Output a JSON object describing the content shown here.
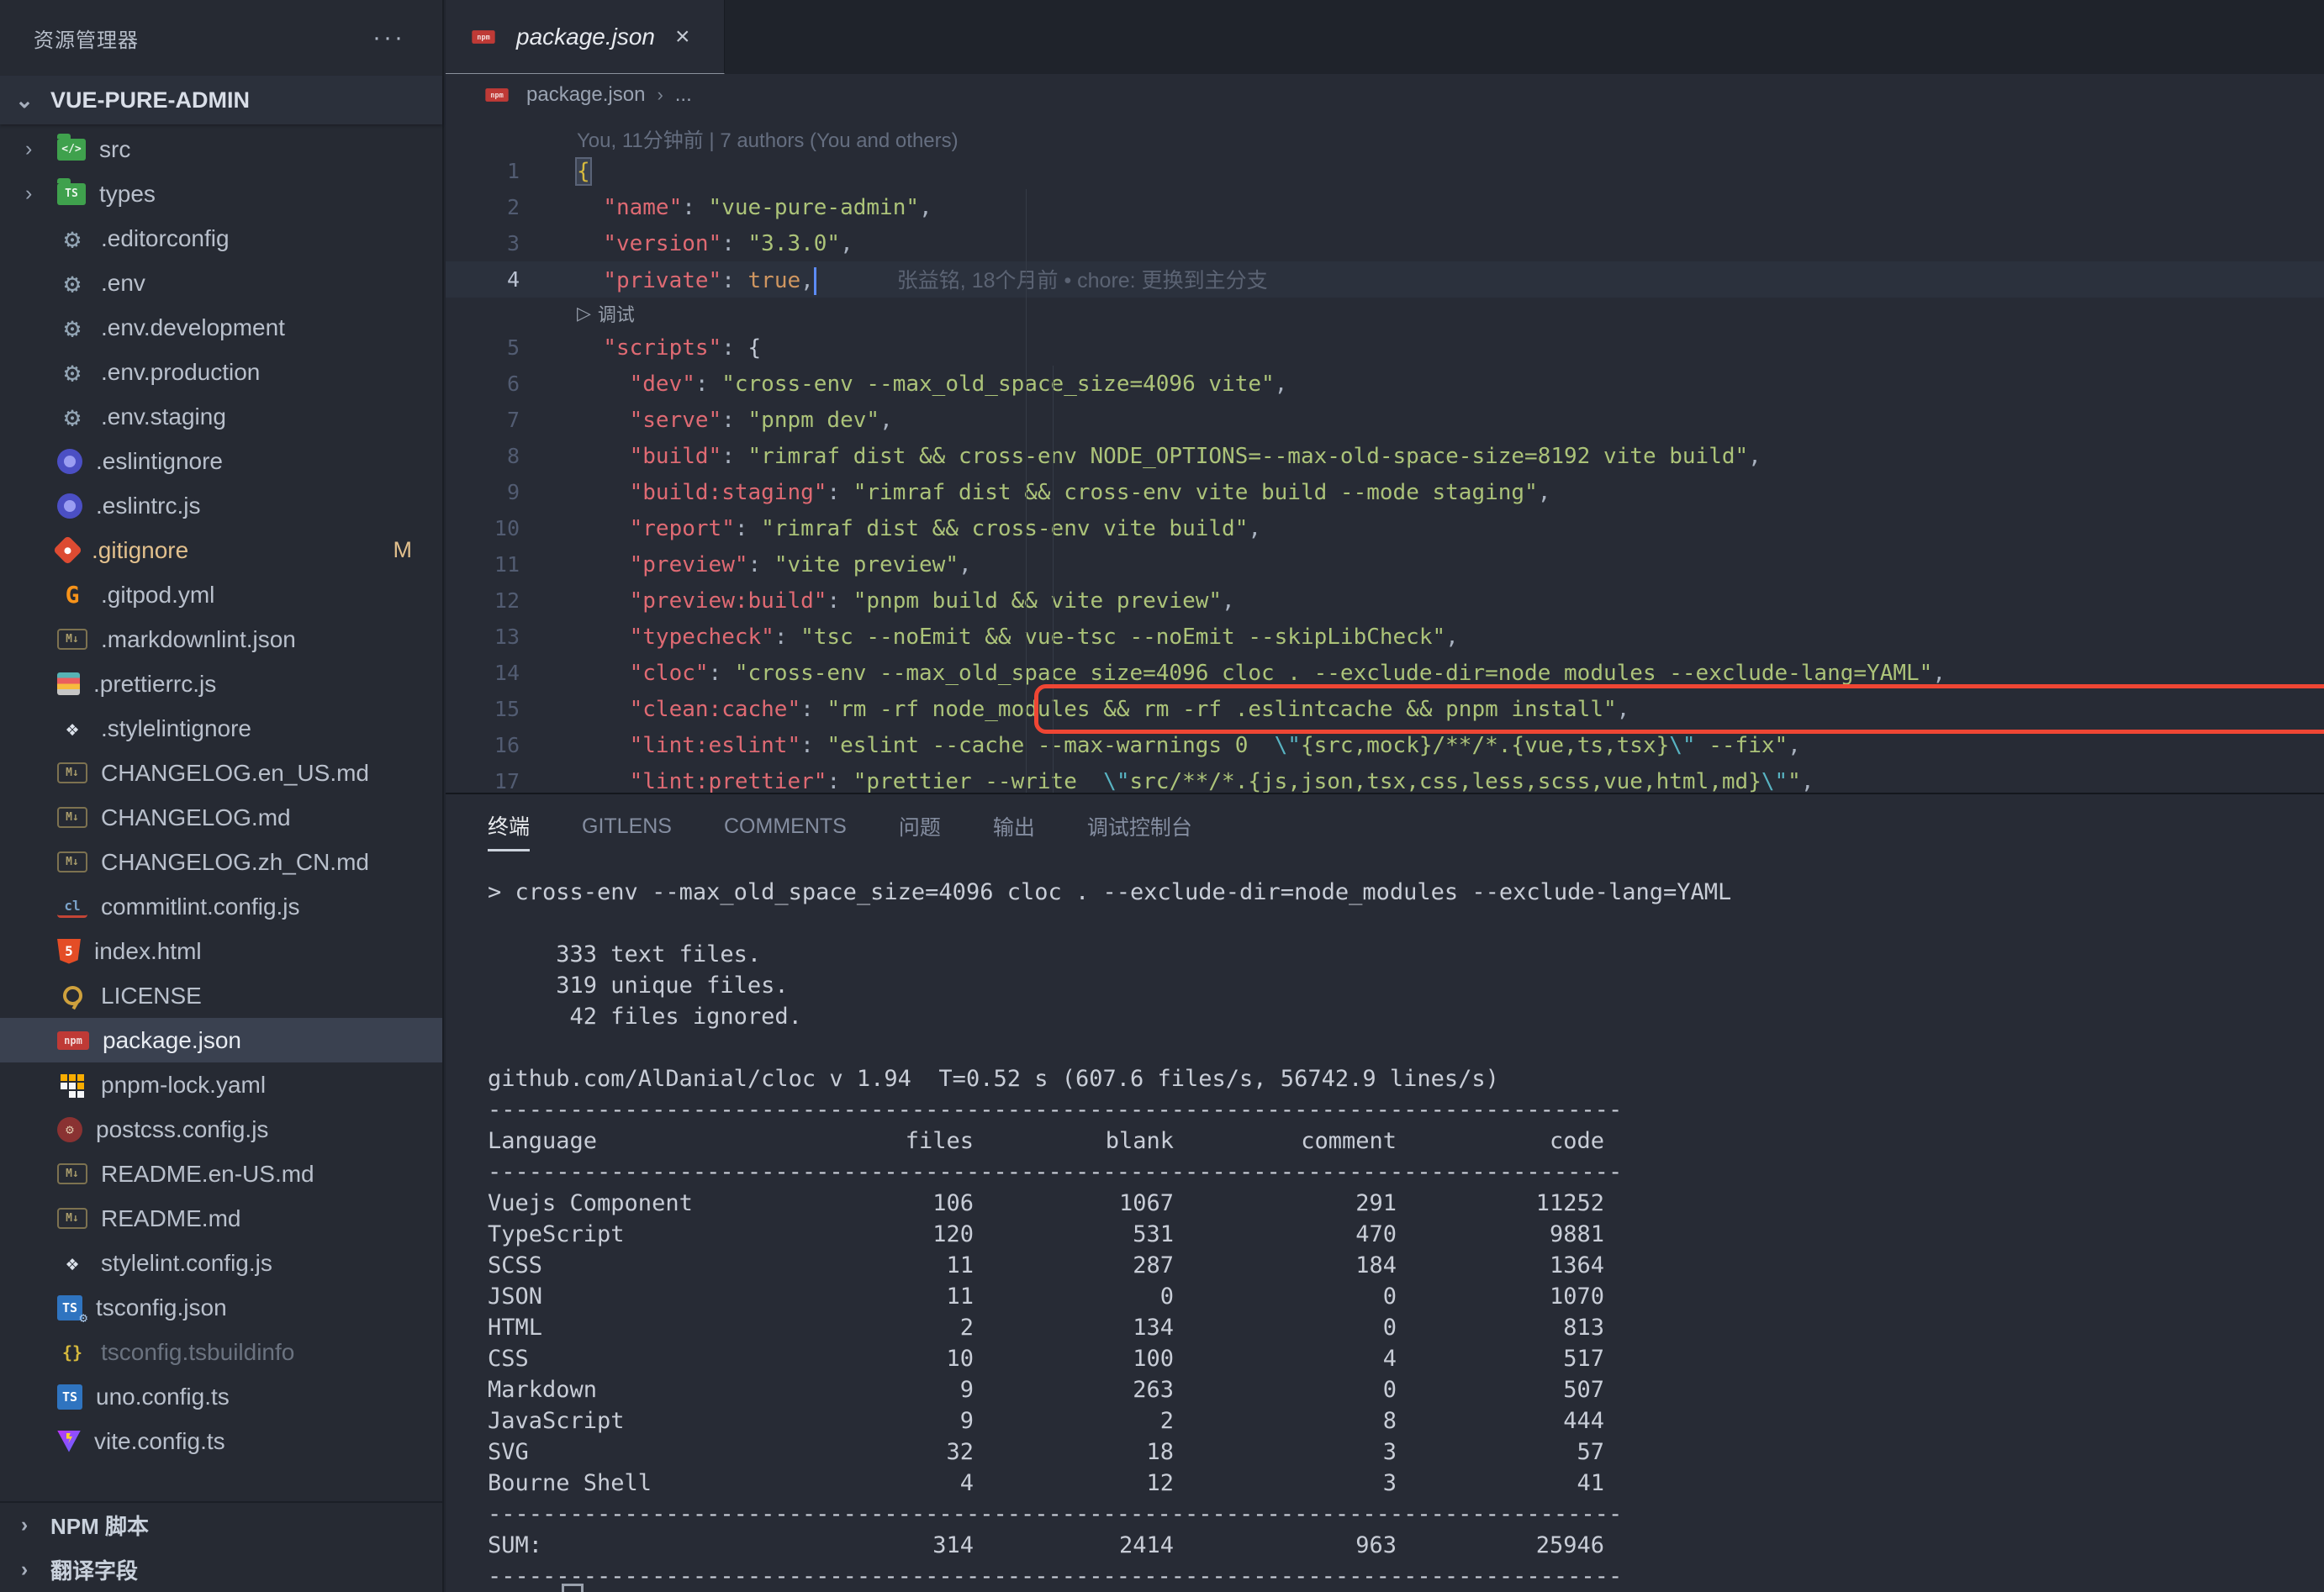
{
  "colors": {
    "accent_red": "#ef4634",
    "modified": "#e2c08d",
    "key": "#df6a73",
    "string": "#acc379",
    "boolean": "#cf9660",
    "selection_bg": "#3a4150"
  },
  "glyphs": {
    "more": "···",
    "chevron_down": "⌄",
    "chevron_right": "›",
    "close": "×",
    "play": "▷",
    "gear": "⚙"
  },
  "sidebar": {
    "title": "资源管理器",
    "project": "VUE-PURE-ADMIN",
    "files": [
      {
        "label": "src",
        "icon": "folder-src",
        "folder": true
      },
      {
        "label": "types",
        "icon": "folder-types",
        "folder": true
      },
      {
        "label": ".editorconfig",
        "icon": "editorconfig"
      },
      {
        "label": ".env",
        "icon": "gear"
      },
      {
        "label": ".env.development",
        "icon": "gear"
      },
      {
        "label": ".env.production",
        "icon": "gear"
      },
      {
        "label": ".env.staging",
        "icon": "gear"
      },
      {
        "label": ".eslintignore",
        "icon": "eslint"
      },
      {
        "label": ".eslintrc.js",
        "icon": "eslint"
      },
      {
        "label": ".gitignore",
        "icon": "git",
        "modified": true,
        "badge": "M"
      },
      {
        "label": ".gitpod.yml",
        "icon": "gitpod"
      },
      {
        "label": ".markdownlint.json",
        "icon": "mdlint"
      },
      {
        "label": ".prettierrc.js",
        "icon": "prettier"
      },
      {
        "label": ".stylelintignore",
        "icon": "stylelint"
      },
      {
        "label": "CHANGELOG.en_US.md",
        "icon": "markdown"
      },
      {
        "label": "CHANGELOG.md",
        "icon": "markdown"
      },
      {
        "label": "CHANGELOG.zh_CN.md",
        "icon": "markdown"
      },
      {
        "label": "commitlint.config.js",
        "icon": "commitlint"
      },
      {
        "label": "index.html",
        "icon": "html"
      },
      {
        "label": "LICENSE",
        "icon": "license"
      },
      {
        "label": "package.json",
        "icon": "npm",
        "selected": true
      },
      {
        "label": "pnpm-lock.yaml",
        "icon": "pnpm"
      },
      {
        "label": "postcss.config.js",
        "icon": "postcss"
      },
      {
        "label": "README.en-US.md",
        "icon": "markdown"
      },
      {
        "label": "README.md",
        "icon": "markdown"
      },
      {
        "label": "stylelint.config.js",
        "icon": "stylelint"
      },
      {
        "label": "tsconfig.json",
        "icon": "ts-gear"
      },
      {
        "label": "tsconfig.tsbuildinfo",
        "icon": "braces",
        "dimmed": true
      },
      {
        "label": "uno.config.ts",
        "icon": "ts"
      },
      {
        "label": "vite.config.ts",
        "icon": "vite"
      }
    ],
    "sections": [
      "NPM 脚本",
      "翻译字段"
    ]
  },
  "tab": {
    "label": "package.json"
  },
  "breadcrumb": {
    "file": "package.json",
    "more": "..."
  },
  "editor": {
    "authors_lens": "You, 11分钟前 | 7 authors (You and others)",
    "lines": [
      {
        "n": 1,
        "raw": "{"
      },
      {
        "n": 2,
        "ind": "  ",
        "key": "\"name\"",
        "val": "\"vue-pure-admin\"",
        "end": ","
      },
      {
        "n": 3,
        "ind": "  ",
        "key": "\"version\"",
        "val": "\"3.3.0\"",
        "end": ","
      },
      {
        "n": 4,
        "ind": "  ",
        "key": "\"private\"",
        "val": "true",
        "vc": "b",
        "end": ",",
        "cursor": true,
        "blame": "张益铭, 18个月前 • chore: 更换到主分支",
        "current": true
      },
      {
        "lens": "调试"
      },
      {
        "n": 5,
        "ind": "  ",
        "key": "\"scripts\"",
        "val": "{",
        "vc": "w",
        "end": ""
      },
      {
        "n": 6,
        "ind": "    ",
        "key": "\"dev\"",
        "val": "\"cross-env --max_old_space_size=4096 vite\"",
        "end": ","
      },
      {
        "n": 7,
        "ind": "    ",
        "key": "\"serve\"",
        "val": "\"pnpm dev\"",
        "end": ","
      },
      {
        "n": 8,
        "ind": "    ",
        "key": "\"build\"",
        "val": "\"rimraf dist && cross-env NODE_OPTIONS=--max-old-space-size=8192 vite build\"",
        "end": ","
      },
      {
        "n": 9,
        "ind": "    ",
        "key": "\"build:staging\"",
        "val": "\"rimraf dist && cross-env vite build --mode staging\"",
        "end": ","
      },
      {
        "n": 10,
        "ind": "    ",
        "key": "\"report\"",
        "val": "\"rimraf dist && cross-env vite build\"",
        "end": ","
      },
      {
        "n": 11,
        "ind": "    ",
        "key": "\"preview\"",
        "val": "\"vite preview\"",
        "end": ","
      },
      {
        "n": 12,
        "ind": "    ",
        "key": "\"preview:build\"",
        "val": "\"pnpm build && vite preview\"",
        "end": ","
      },
      {
        "n": 13,
        "ind": "    ",
        "key": "\"typecheck\"",
        "val": "\"tsc --noEmit && vue-tsc --noEmit --skipLibCheck\"",
        "end": ","
      },
      {
        "n": 14,
        "ind": "    ",
        "key": "\"cloc\"",
        "val": "\"cross-env --max_old_space_size=4096 cloc . --exclude-dir=node_modules --exclude-lang=YAML\"",
        "end": ",",
        "highlight": true
      },
      {
        "n": 15,
        "ind": "    ",
        "key": "\"clean:cache\"",
        "val": "\"rm -rf node_modules && rm -rf .eslintcache && pnpm install\"",
        "end": ","
      },
      {
        "n": 16,
        "ind": "    ",
        "key": "\"lint:eslint\"",
        "val": "\"eslint --cache --max-warnings 0  \\\"{src,mock}/**/*.{vue,ts,tsx}\\\" --fix\"",
        "end": ","
      },
      {
        "n": 17,
        "ind": "    ",
        "key": "\"lint:prettier\"",
        "val": "\"prettier --write  \\\"src/**/*.{js,json,tsx,css,less,scss,vue,html,md}\\\"\"",
        "end": ","
      }
    ]
  },
  "panel": {
    "tabs": [
      {
        "label": "终端",
        "active": true
      },
      {
        "label": "GITLENS"
      },
      {
        "label": "COMMENTS"
      },
      {
        "label": "问题"
      },
      {
        "label": "输出"
      },
      {
        "label": "调试控制台"
      }
    ]
  },
  "terminal": {
    "command": "> cross-env --max_old_space_size=4096 cloc . --exclude-dir=node_modules --exclude-lang=YAML",
    "summary": [
      "     333 text files.",
      "     319 unique files.",
      "      42 files ignored."
    ],
    "info": "github.com/AlDanial/cloc v 1.94  T=0.52 s (607.6 files/s, 56742.9 lines/s)",
    "separator": "-----------------------------------------------------------------------------------",
    "table": {
      "headers": [
        "Language",
        "files",
        "blank",
        "comment",
        "code"
      ],
      "rows": [
        [
          "Vuejs Component",
          "106",
          "1067",
          "291",
          "11252"
        ],
        [
          "TypeScript",
          "120",
          "531",
          "470",
          "9881"
        ],
        [
          "SCSS",
          "11",
          "287",
          "184",
          "1364"
        ],
        [
          "JSON",
          "11",
          "0",
          "0",
          "1070"
        ],
        [
          "HTML",
          "2",
          "134",
          "0",
          "813"
        ],
        [
          "CSS",
          "10",
          "100",
          "4",
          "517"
        ],
        [
          "Markdown",
          "9",
          "263",
          "0",
          "507"
        ],
        [
          "JavaScript",
          "9",
          "2",
          "8",
          "444"
        ],
        [
          "SVG",
          "32",
          "18",
          "3",
          "57"
        ],
        [
          "Bourne Shell",
          "4",
          "12",
          "3",
          "41"
        ]
      ],
      "sum": [
        "SUM:",
        "314",
        "2414",
        "963",
        "25946"
      ]
    }
  }
}
